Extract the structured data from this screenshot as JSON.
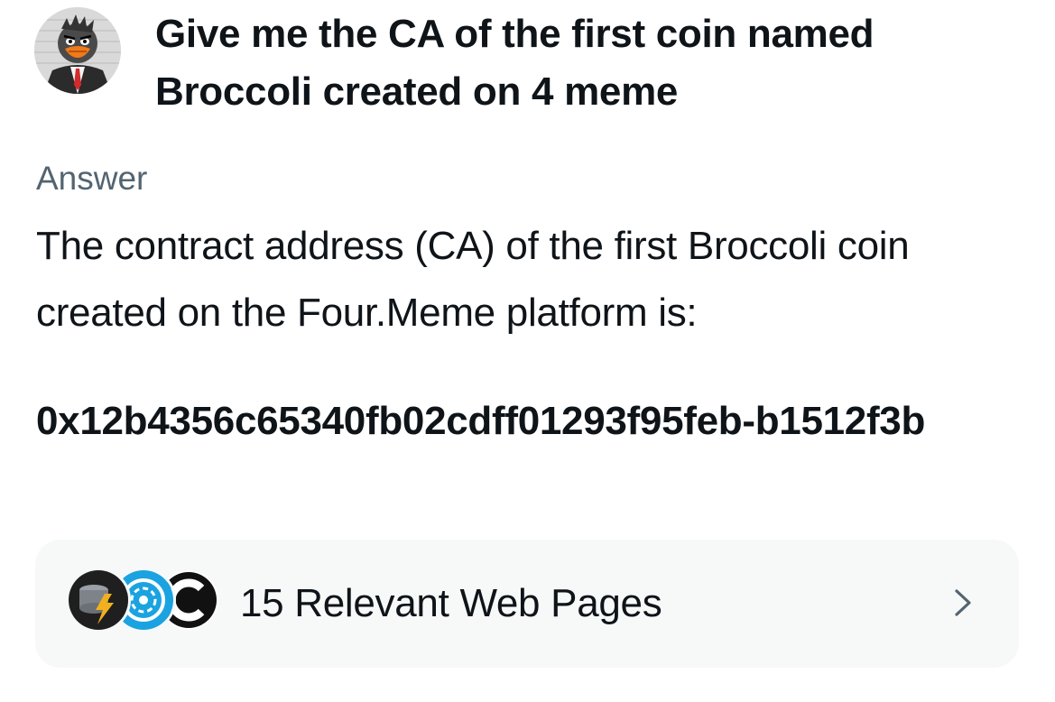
{
  "question": {
    "text": "Give me the CA of the first coin named Broccoli created on 4 meme"
  },
  "answer": {
    "label": "Answer",
    "text": "The contract address (CA) of the first Broccoli coin created on the Four.Meme platform is:",
    "contract_address": "0x12b4356c65340fb02cdff01293f95feb-b1512f3b"
  },
  "sources": {
    "label": "15 Relevant Web Pages",
    "icons": [
      "coin-stack-icon",
      "coinmarketcap-icon",
      "coingecko-c-icon"
    ]
  },
  "colors": {
    "text": "#0f1419",
    "muted": "#536471",
    "card_bg": "#f7f9f9"
  }
}
